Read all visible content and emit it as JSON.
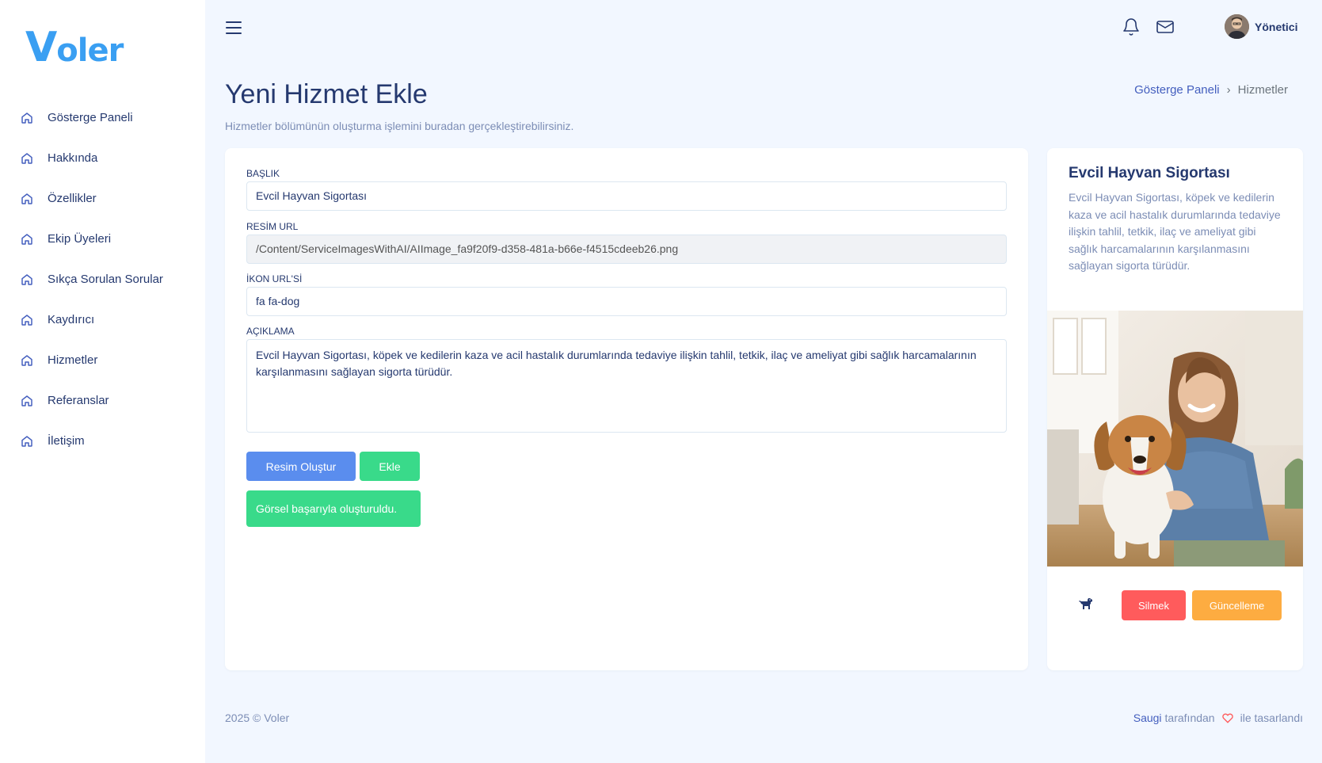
{
  "brand": {
    "logo_first": "V",
    "logo_rest": "oler"
  },
  "sidebar": {
    "items": [
      {
        "label": "Gösterge Paneli",
        "icon": "home-icon"
      },
      {
        "label": "Hakkında",
        "icon": "home-icon"
      },
      {
        "label": "Özellikler",
        "icon": "home-icon"
      },
      {
        "label": "Ekip Üyeleri",
        "icon": "home-icon"
      },
      {
        "label": "Sıkça Sorulan Sorular",
        "icon": "home-icon"
      },
      {
        "label": "Kaydırıcı",
        "icon": "home-icon"
      },
      {
        "label": "Hizmetler",
        "icon": "home-icon"
      },
      {
        "label": "Referanslar",
        "icon": "home-icon"
      },
      {
        "label": "İletişim",
        "icon": "home-icon"
      }
    ]
  },
  "header": {
    "menu_icon": "hamburger-icon",
    "notification_icon": "bell-icon",
    "mail_icon": "mail-icon",
    "user_name": "Yönetici"
  },
  "page": {
    "title": "Yeni Hizmet Ekle",
    "subtitle": "Hizmetler bölümünün oluşturma işlemini buradan gerçekleştirebilirsiniz.",
    "breadcrumb": {
      "home": "Gösterge Paneli",
      "current": "Hizmetler"
    }
  },
  "form": {
    "title_label": "BAŞLIK",
    "title_value": "Evcil Hayvan Sigortası",
    "image_url_label": "RESİM URL",
    "image_url_value": "/Content/ServiceImagesWithAI/AIImage_fa9f20f9-d358-481a-b66e-f4515cdeeb26.png",
    "icon_url_label": "İKON URL'Sİ",
    "icon_url_value": "fa fa-dog",
    "description_label": "AÇIKLAMA",
    "description_value": "Evcil Hayvan Sigortası, köpek ve kedilerin kaza ve acil hastalık durumlarında tedaviye ilişkin tahlil, tetkik, ilaç ve ameliyat gibi sağlık harcamalarının karşılanmasını sağlayan sigorta türüdür.",
    "generate_button": "Resim Oluştur",
    "add_button": "Ekle",
    "success_message": "Görsel başarıyla oluşturuldu."
  },
  "preview": {
    "title": "Evcil Hayvan Sigortası",
    "description": "Evcil Hayvan Sigortası, köpek ve kedilerin kaza ve acil hastalık durumlarında tedaviye ilişkin tahlil, tetkik, ilaç ve ameliyat gibi sağlık harcamalarının karşılanmasını sağlayan sigorta türüdür.",
    "icon": "dog-icon",
    "delete_button": "Silmek",
    "update_button": "Güncelleme"
  },
  "footer": {
    "copyright": "2025 © Voler",
    "author_link": "Saugi",
    "by_text": "tarafından",
    "designed_text": "ile tasarlandı"
  },
  "colors": {
    "primary": "#435ebe",
    "blue_button": "#5a8dee",
    "green": "#39da8a",
    "red": "#ff5b5c",
    "orange": "#fdac41",
    "background": "#f2f7ff"
  }
}
